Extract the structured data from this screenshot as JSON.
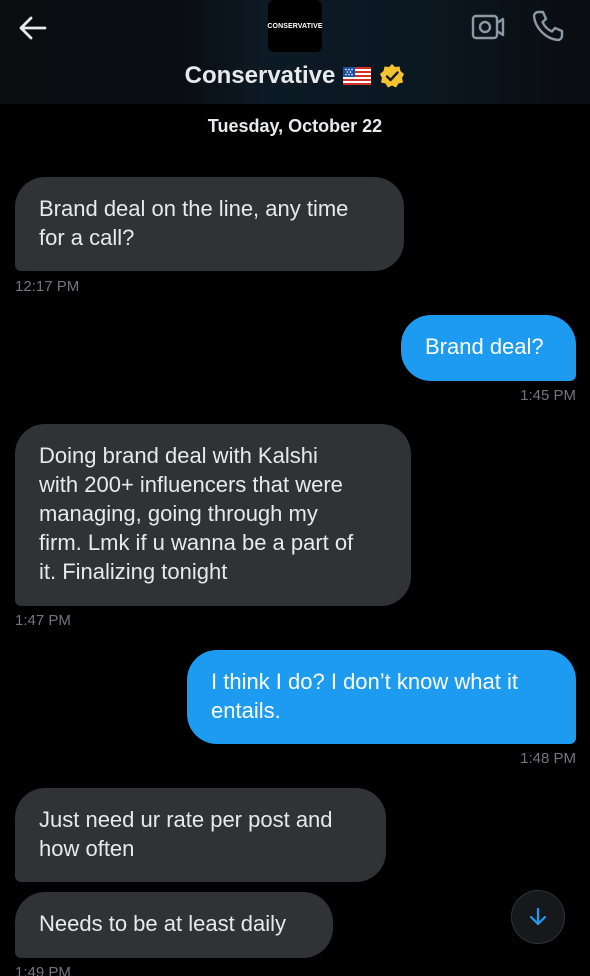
{
  "header": {
    "avatar_text": "CONSERVATIVE",
    "title": "Conservative",
    "flag_emoji": "🇺🇸",
    "verified_color": "#f4c430"
  },
  "date_divider": "Tuesday, October 22",
  "messages": [
    {
      "direction": "in",
      "text": "Brand deal on the line, any time\nfor a call?",
      "time": "12:17 PM"
    },
    {
      "direction": "out",
      "text": "Brand deal?",
      "time": "1:45 PM"
    },
    {
      "direction": "in",
      "text": "Doing brand deal with Kalshi\nwith 200+ influencers that were\nmanaging, going through my\nfirm. Lmk if u wanna be a part of\nit. Finalizing tonight",
      "time": "1:47 PM"
    },
    {
      "direction": "out",
      "text": "I think I do? I don’t know what it\nentails.",
      "time": "1:48 PM"
    },
    {
      "direction": "in",
      "text": "Just need ur rate per post and\nhow often",
      "time": ""
    },
    {
      "direction": "in",
      "text": "Needs to be at least daily",
      "time": "1:49 PM"
    }
  ],
  "colors": {
    "incoming_bubble": "#2f3336",
    "outgoing_bubble": "#1d9bf0",
    "timestamp": "#71767b",
    "accent": "#1d9bf0"
  },
  "icons": {
    "back": "arrow-left-icon",
    "video": "video-camera-icon",
    "phone": "phone-icon",
    "scroll": "arrow-down-icon"
  }
}
